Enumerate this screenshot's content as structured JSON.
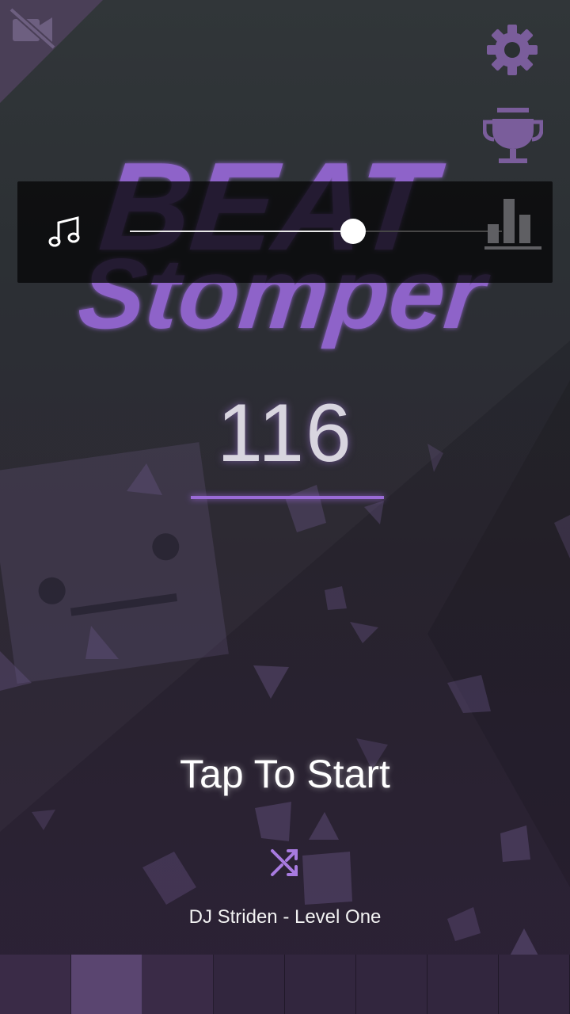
{
  "game": {
    "logo_line1": "BEAT",
    "logo_line2": "Stomper",
    "score": "116",
    "start_prompt": "Tap To Start",
    "track": "DJ Striden - Level One"
  },
  "volume": {
    "level": 0.6
  },
  "icons": {
    "top_left": "camera-off-icon",
    "top_right": "settings-icon",
    "second_right": "trophy-icon",
    "music": "music-note-icon",
    "equalizer": "equalizer-icon",
    "shuffle": "shuffle-icon"
  },
  "colors": {
    "accent": "#9a6bd6",
    "logo_fill": "#8e63c9",
    "icon_purple": "#7a5d9b"
  },
  "tiles": [
    "#3a2b47",
    "#5a4570",
    "#3a2b47",
    "#32263e",
    "#32263e",
    "#32263e",
    "#32263e",
    "#32263e"
  ]
}
